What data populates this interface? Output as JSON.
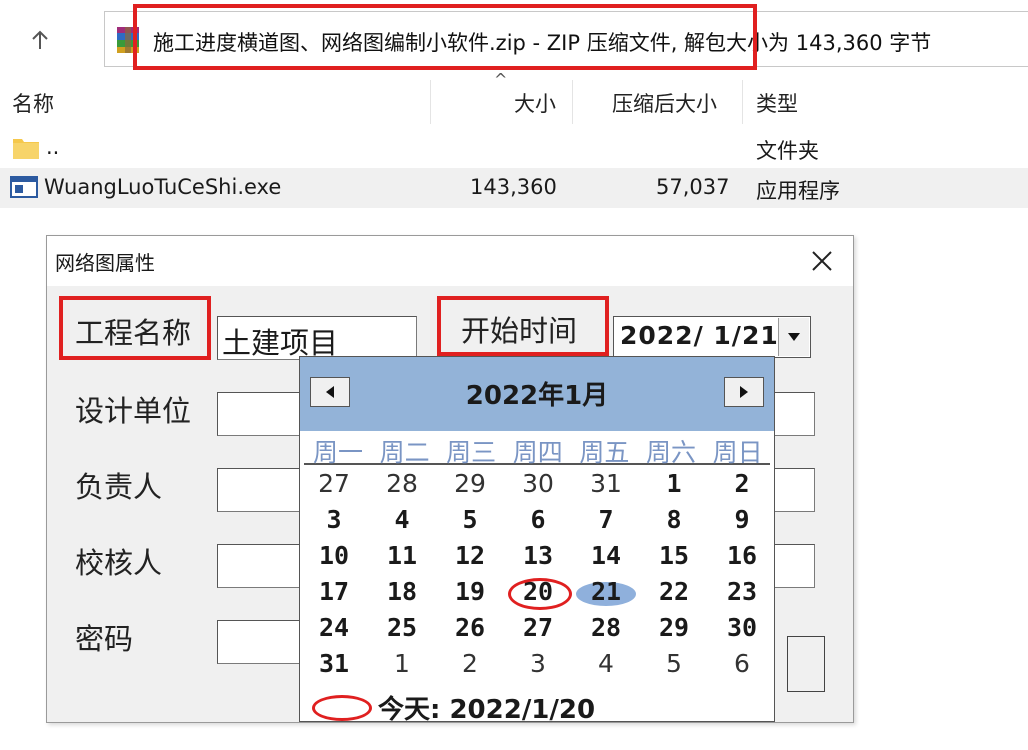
{
  "address_bar": {
    "path": "施工进度横道图、网络图编制小软件.zip - ZIP 压缩文件, 解包大小为 143,360 字节"
  },
  "columns": [
    "名称",
    "大小",
    "压缩后大小",
    "类型"
  ],
  "rows": [
    {
      "name": "..",
      "size": "",
      "packed": "",
      "type": "文件夹"
    },
    {
      "name": "WuangLuoTuCeShi.exe",
      "size": "143,360",
      "packed": "57,037",
      "type": "应用程序"
    }
  ],
  "dialog": {
    "title": "网络图属性",
    "labels": {
      "project_name": "工程名称",
      "design_unit": "设计单位",
      "responsible": "负责人",
      "checker": "校核人",
      "password": "密码",
      "start_time": "开始时间"
    },
    "project_value": "土建项目",
    "start_date": "2022/ 1/21"
  },
  "calendar": {
    "month_title": "2022年1月",
    "weekdays": [
      "周一",
      "周二",
      "周三",
      "周四",
      "周五",
      "周六",
      "周日"
    ],
    "weeks": [
      [
        "27",
        "28",
        "29",
        "30",
        "31",
        "1",
        "2"
      ],
      [
        "3",
        "4",
        "5",
        "6",
        "7",
        "8",
        "9"
      ],
      [
        "10",
        "11",
        "12",
        "13",
        "14",
        "15",
        "16"
      ],
      [
        "17",
        "18",
        "19",
        "20",
        "21",
        "22",
        "23"
      ],
      [
        "24",
        "25",
        "26",
        "27",
        "28",
        "29",
        "30"
      ],
      [
        "31",
        "1",
        "2",
        "3",
        "4",
        "5",
        "6"
      ]
    ],
    "selected_day": "21",
    "today_label": "今天: 2022/1/20"
  },
  "colors": {
    "annotation_red": "#e02020",
    "calendar_header": "#93b3d8",
    "weekday_blue": "#7a95c4"
  }
}
